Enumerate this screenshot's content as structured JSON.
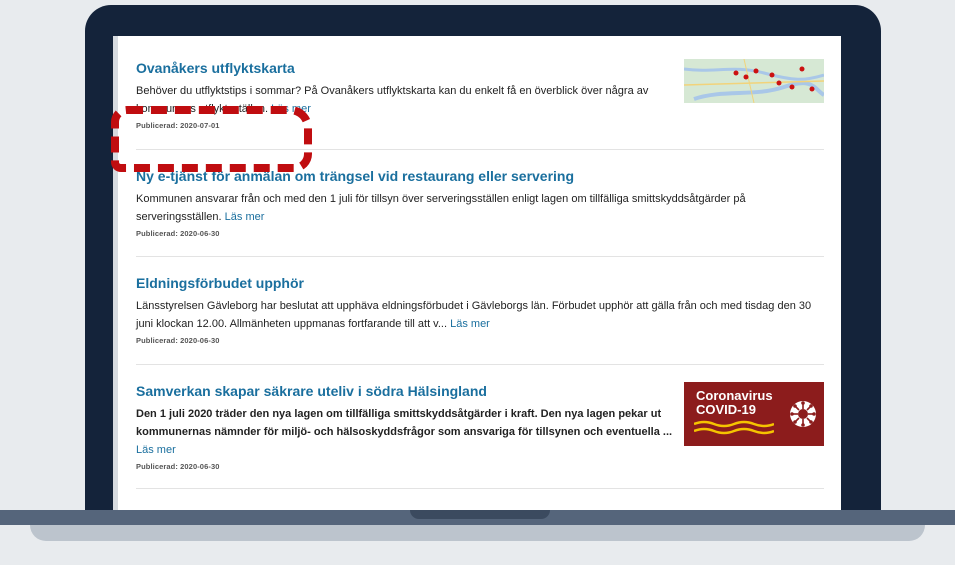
{
  "articles": [
    {
      "title": "Ovanåkers utflyktskarta",
      "text": "Behöver du utflyktstips i sommar? På Ovanåkers utflyktskarta kan du enkelt få en överblick över några av kommunens utflyktsställen.",
      "read_more": "Läs mer",
      "published": "Publicerad: 2020-07-01"
    },
    {
      "title": "Ny e-tjänst för anmälan om trängsel vid restaurang eller servering",
      "text": "Kommunen ansvarar från och med den 1 juli för tillsyn över serveringsställen enligt lagen om tillfälliga smittskyddsåtgärder på serveringsställen.",
      "read_more": "Läs mer",
      "published": "Publicerad: 2020-06-30"
    },
    {
      "title": "Eldningsförbudet upphör",
      "text": "Länsstyrelsen Gävleborg har beslutat att upphäva eldningsförbudet i Gävleborgs län. Förbudet upphör att gälla från och med tisdag den 30 juni klockan 12.00. Allmänheten uppmanas fortfarande till att v...",
      "read_more": "Läs mer",
      "published": "Publicerad: 2020-06-30"
    },
    {
      "title": "Samverkan skapar säkrare uteliv i södra Hälsingland",
      "text": "Den 1 juli 2020 träder den nya lagen om tillfälliga smittskyddsåtgärder i kraft. Den nya lagen pekar ut kommunernas nämnder för miljö- och hälsoskyddsfrågor som ansvariga för tillsynen och eventuella ...",
      "read_more": "Läs mer",
      "published": "Publicerad: 2020-06-30"
    }
  ],
  "covid_badge": {
    "line1": "Coronavirus",
    "line2": "COVID-19"
  },
  "colors": {
    "link": "#1a6f9e",
    "annotation": "#c00d10",
    "covid_bg": "#8c1c1c",
    "laptop_frame": "#14233a"
  }
}
